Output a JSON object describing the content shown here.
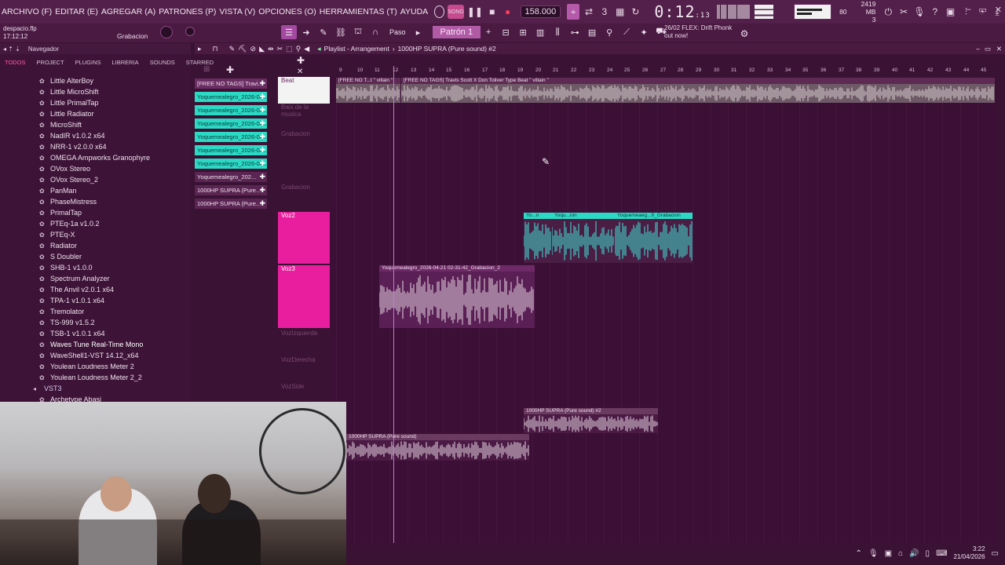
{
  "menu": {
    "items": [
      "ARCHIVO (F)",
      "EDITAR (E)",
      "AGREGAR (A)",
      "PATRONES (P)",
      "VISTA (V)",
      "OPCIONES (O)",
      "HERRAMIENTAS (T)",
      "AYUDA"
    ]
  },
  "transport": {
    "mode_label": "SONG",
    "tempo": "158.000",
    "time": "0:12",
    "time_frac": ":13",
    "time_unit": "M:S:CS",
    "cpu_value": "80",
    "memory": "2419 MB",
    "voices": "3"
  },
  "project": {
    "filename": "despacio.flp",
    "time": "17:12:12",
    "recording_label": "Grabacion"
  },
  "toolbar2": {
    "step_label": "Paso",
    "pattern_label": "Patrón 1",
    "news_line1": "26/02  FLEX: Drift Phonk",
    "news_line2": "out now!"
  },
  "browser": {
    "title": "Navegador",
    "tabs": [
      "TODOS",
      "PROJECT",
      "PLUGINS",
      "LIBRERIA",
      "SOUNDS",
      "STARRED"
    ],
    "plugins": [
      "Little AlterBoy",
      "Little MicroShift",
      "Little PrimalTap",
      "Little Radiator",
      "MicroShift",
      "NadIR v1.0.2 x64",
      "NRR-1 v2.0.0 x64",
      "OMEGA Ampworks Granophyre",
      "OVox Stereo",
      "OVox Stereo_2",
      "PanMan",
      "PhaseMistress",
      "PrimalTap",
      "PTEq-1a v1.0.2",
      "PTEq-X",
      "Radiator",
      "S Doubler",
      "SHB-1 v1.0.0",
      "Spectrum Analyzer",
      "The Anvil v2.0.1 x64",
      "TPA-1 v1.0.1 x64",
      "Tremolator",
      "TS-999 v1.5.2",
      "TSB-1 v1.0.1 x64"
    ],
    "highlighted": "Waves Tune Real-Time Mono",
    "plugins_after": [
      "WaveShell1-VST 14.12_x64",
      "Youlean Loudness Meter 2",
      "Youlean Loudness Meter 2_2"
    ],
    "folder": "VST3",
    "last_item": "Archetype Abasi"
  },
  "patterns": [
    {
      "label": "[FREE NO TAGS] Travi...",
      "style": "first"
    },
    {
      "label": "Yoquemealegro_2026-04...",
      "style": "cyan"
    },
    {
      "label": "Yoquemealegro_2026-04...",
      "style": "cyan"
    },
    {
      "label": "Yoquemealegro_2026-04...",
      "style": "cyan"
    },
    {
      "label": "Yoquemealegro_2026-04...",
      "style": "cyan"
    },
    {
      "label": "Yoquemealegro_2026-04...",
      "style": "cyan"
    },
    {
      "label": "Yoquemealegro_2026-04...",
      "style": "cyan"
    },
    {
      "label": "Yoquemealegro_202...",
      "style": "dark"
    },
    {
      "label": "1000HP SUPRA (Pure...",
      "style": "dark"
    },
    {
      "label": "1000HP SUPRA (Pure...",
      "style": "dark"
    }
  ],
  "playlist": {
    "title": "Playlist - Arrangement",
    "pattern": "1000HP SUPRA (Pure sound) #2",
    "ruler": [
      "9",
      "10",
      "11",
      "12",
      "13",
      "14",
      "15",
      "16",
      "17",
      "18",
      "19",
      "20",
      "21",
      "22",
      "23",
      "24",
      "25",
      "26",
      "27",
      "28",
      "29",
      "30",
      "31",
      "32",
      "33",
      "34",
      "35",
      "36",
      "37",
      "38",
      "39",
      "40",
      "41",
      "42",
      "43",
      "44",
      "45"
    ],
    "tracks": {
      "beat": "Beat",
      "t2": "Baix de la musica",
      "t3": "Grabacion",
      "t4": "Grabacion",
      "voz2": "Voz2",
      "voz3": "Voz3",
      "t7": "VozIzquierda",
      "t8": "VozDerecha",
      "t9": "VozSide"
    },
    "clips": {
      "beat_a": "[FREE NO T...t \" villain \"",
      "beat_b": "[FREE NO TAGS] Travis Scott X Don Toliver Type Beat \" villain \"",
      "voz2_a": "Yo...n",
      "voz2_b": "Yoqu...ion",
      "voz2_c": "Yoquemeaeg...9_Grabacion",
      "voz3": "Yoquemealegro_2026-04-21 02-31-42_Grabacion_2",
      "supra2": "1000HP SUPRA (Pure sound) #2",
      "supra1": "1000HP SUPRA (Pure sound)"
    }
  },
  "taskbar": {
    "time": "3:22",
    "date": "21/04/2026"
  }
}
